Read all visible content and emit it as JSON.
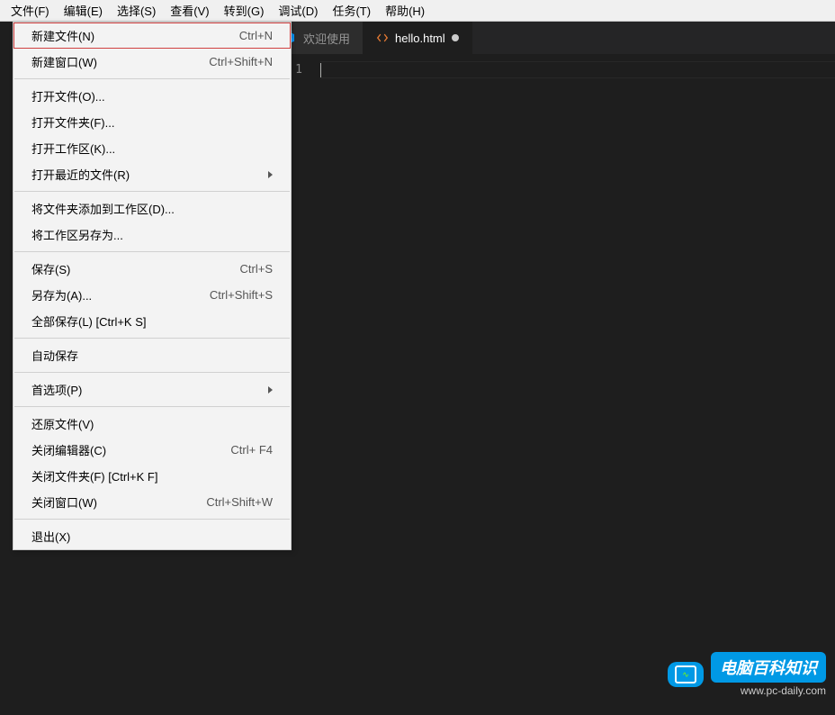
{
  "menubar": [
    "文件(F)",
    "编辑(E)",
    "选择(S)",
    "查看(V)",
    "转到(G)",
    "调试(D)",
    "任务(T)",
    "帮助(H)"
  ],
  "file_menu": {
    "groups": [
      [
        {
          "label": "新建文件(N)",
          "shortcut": "Ctrl+N",
          "highlighted": true
        },
        {
          "label": "新建窗口(W)",
          "shortcut": "Ctrl+Shift+N"
        }
      ],
      [
        {
          "label": "打开文件(O)...",
          "shortcut": ""
        },
        {
          "label": "打开文件夹(F)...",
          "shortcut": ""
        },
        {
          "label": "打开工作区(K)...",
          "shortcut": ""
        },
        {
          "label": "打开最近的文件(R)",
          "shortcut": "",
          "submenu": true
        }
      ],
      [
        {
          "label": "将文件夹添加到工作区(D)...",
          "shortcut": ""
        },
        {
          "label": "将工作区另存为...",
          "shortcut": ""
        }
      ],
      [
        {
          "label": "保存(S)",
          "shortcut": "Ctrl+S"
        },
        {
          "label": "另存为(A)...",
          "shortcut": "Ctrl+Shift+S"
        },
        {
          "label": "全部保存(L) [Ctrl+K S]",
          "shortcut": ""
        }
      ],
      [
        {
          "label": "自动保存",
          "shortcut": ""
        }
      ],
      [
        {
          "label": "首选项(P)",
          "shortcut": "",
          "submenu": true
        }
      ],
      [
        {
          "label": "还原文件(V)",
          "shortcut": ""
        },
        {
          "label": "关闭编辑器(C)",
          "shortcut": "Ctrl+ F4"
        },
        {
          "label": "关闭文件夹(F) [Ctrl+K F]",
          "shortcut": ""
        },
        {
          "label": "关闭窗口(W)",
          "shortcut": "Ctrl+Shift+W"
        }
      ],
      [
        {
          "label": "退出(X)",
          "shortcut": ""
        }
      ]
    ]
  },
  "tabs": [
    {
      "label": "欢迎使用",
      "icon": "vscode",
      "active": false
    },
    {
      "label": "hello.html",
      "icon": "html",
      "active": true,
      "dirty": true
    }
  ],
  "gutter": {
    "line1": "1"
  },
  "watermark": {
    "brand": "电脑百科知识",
    "url": "www.pc-daily.com"
  }
}
